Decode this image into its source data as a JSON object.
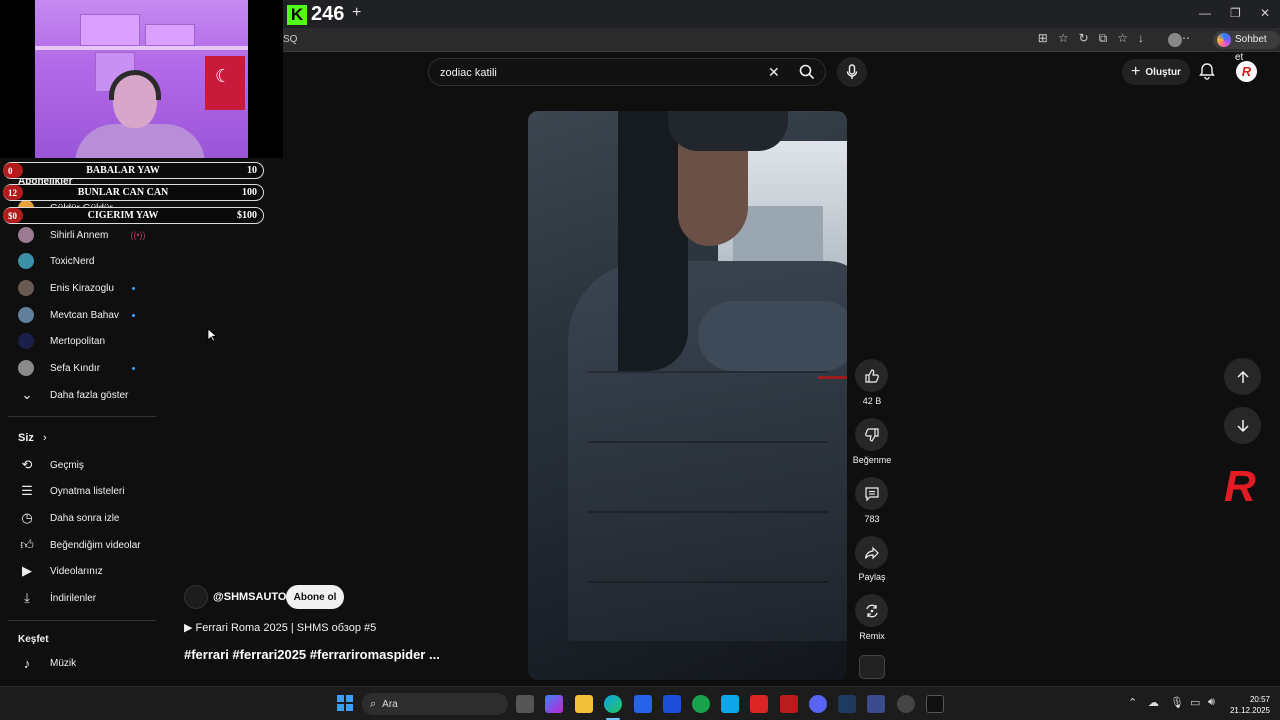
{
  "browser": {
    "kick_count": "246",
    "url_fragment": "SQ",
    "sohbet_label": "Sohbet et"
  },
  "scoreboard": [
    {
      "num": "0",
      "name": "BABALAR YAW",
      "value": "10"
    },
    {
      "num": "12",
      "name": "BUNLAR CAN CAN",
      "value": "100"
    },
    {
      "num": "$0",
      "name": "CIGERIM YAW",
      "value": "$100"
    }
  ],
  "sidebar": {
    "subscriptions_header": "Abonelikler",
    "subscriptions": [
      {
        "label": "Güldür Güldür",
        "new": false
      },
      {
        "label": "Sihirli Annem",
        "new": false
      },
      {
        "label": "ToxicNerd",
        "new": false
      },
      {
        "label": "Enis Kirazoglu",
        "new": true
      },
      {
        "label": "Mevtcan Bahav",
        "new": true
      },
      {
        "label": "Mertopolitan",
        "new": false
      },
      {
        "label": "Sefa Kındır",
        "new": true
      }
    ],
    "show_more": "Daha fazla göster",
    "you_header": "Siz",
    "you_items": [
      {
        "label": "Geçmiş",
        "icon": "history-icon"
      },
      {
        "label": "Oynatma listeleri",
        "icon": "playlist-icon"
      },
      {
        "label": "Daha sonra izle",
        "icon": "clock-icon"
      },
      {
        "label": "Beğendiğim videolar",
        "icon": "like-icon"
      },
      {
        "label": "Videolarınız",
        "icon": "video-icon"
      },
      {
        "label": "İndirilenler",
        "icon": "download-icon"
      }
    ],
    "explore_header": "Keşfet",
    "explore_items": [
      {
        "label": "Müzik",
        "icon": "music-icon"
      }
    ]
  },
  "search": {
    "value": "zodiac katili"
  },
  "header": {
    "create_label": "Oluştur",
    "profile_letter": "R"
  },
  "actions": {
    "like_count": "42 B",
    "dislike_label": "Beğenme",
    "comment_count": "783",
    "share_label": "Paylaş",
    "remix_label": "Remix"
  },
  "video": {
    "channel": "@SHMSAUTO",
    "subscribe_label": "Abone ol",
    "title": "▶ Ferrari Roma 2025 | SHMS обзор #5",
    "tags": "#ferrari #ferrari2025 #ferrariromaspider ..."
  },
  "taskbar": {
    "search_label": "Ara",
    "time": "20:57",
    "date": "21.12.2025"
  },
  "colors": {
    "accent_red": "#e31b23",
    "kick_green": "#53fc18",
    "background": "#0f0f0f"
  }
}
